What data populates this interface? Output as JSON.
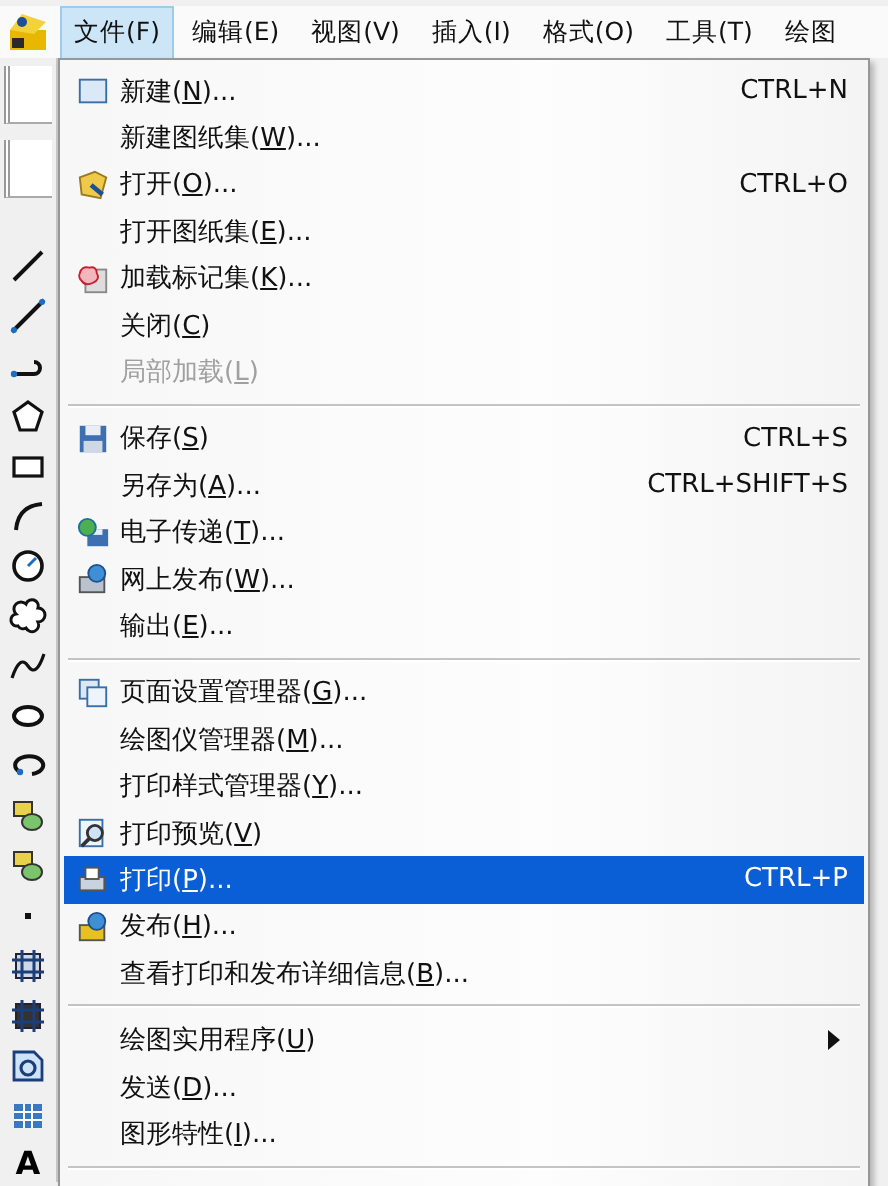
{
  "menu_bar": {
    "items": [
      {
        "label": "文件(F)",
        "selected": true
      },
      {
        "label": "编辑(E)",
        "selected": false
      },
      {
        "label": "视图(V)",
        "selected": false
      },
      {
        "label": "插入(I)",
        "selected": false
      },
      {
        "label": "格式(O)",
        "selected": false
      },
      {
        "label": "工具(T)",
        "selected": false
      },
      {
        "label": "绘图",
        "selected": false
      }
    ]
  },
  "file_menu": {
    "groups": [
      {
        "items": [
          {
            "label": "新建(N)...",
            "shortcut": "CTRL+N",
            "disabled": false,
            "selected": false,
            "submenu": false
          },
          {
            "label": "新建图纸集(W)...",
            "disabled": false,
            "selected": false,
            "submenu": false
          },
          {
            "label": "打开(O)...",
            "shortcut": "CTRL+O",
            "disabled": false,
            "selected": false,
            "submenu": false
          },
          {
            "label": "打开图纸集(E)...",
            "disabled": false,
            "selected": false,
            "submenu": false
          },
          {
            "label": "加载标记集(K)...",
            "disabled": false,
            "selected": false,
            "submenu": false
          },
          {
            "label": "关闭(C)",
            "disabled": false,
            "selected": false,
            "submenu": false
          },
          {
            "label": "局部加载(L)",
            "disabled": true,
            "selected": false,
            "submenu": false
          }
        ]
      },
      {
        "items": [
          {
            "label": "保存(S)",
            "shortcut": "CTRL+S",
            "disabled": false,
            "selected": false,
            "submenu": false
          },
          {
            "label": "另存为(A)...",
            "shortcut": "CTRL+SHIFT+S",
            "disabled": false,
            "selected": false,
            "submenu": false
          },
          {
            "label": "电子传递(T)...",
            "disabled": false,
            "selected": false,
            "submenu": false
          },
          {
            "label": "网上发布(W)...",
            "disabled": false,
            "selected": false,
            "submenu": false
          },
          {
            "label": "输出(E)...",
            "disabled": false,
            "selected": false,
            "submenu": false
          }
        ]
      },
      {
        "items": [
          {
            "label": "页面设置管理器(G)...",
            "disabled": false,
            "selected": false,
            "submenu": false
          },
          {
            "label": "绘图仪管理器(M)...",
            "disabled": false,
            "selected": false,
            "submenu": false
          },
          {
            "label": "打印样式管理器(Y)...",
            "disabled": false,
            "selected": false,
            "submenu": false
          },
          {
            "label": "打印预览(V)",
            "disabled": false,
            "selected": false,
            "submenu": false
          },
          {
            "label": "打印(P)...",
            "shortcut": "CTRL+P",
            "disabled": false,
            "selected": true,
            "submenu": false
          },
          {
            "label": "发布(H)...",
            "disabled": false,
            "selected": false,
            "submenu": false
          },
          {
            "label": "查看打印和发布详细信息(B)...",
            "disabled": false,
            "selected": false,
            "submenu": false
          }
        ]
      },
      {
        "items": [
          {
            "label": "绘图实用程序(U)",
            "disabled": false,
            "selected": false,
            "submenu": true
          },
          {
            "label": "发送(D)...",
            "disabled": false,
            "selected": false,
            "submenu": false
          },
          {
            "label": "图形特性(I)...",
            "disabled": false,
            "selected": false,
            "submenu": false
          }
        ]
      }
    ]
  },
  "draw_toolbar": {
    "text_tool": "A"
  }
}
